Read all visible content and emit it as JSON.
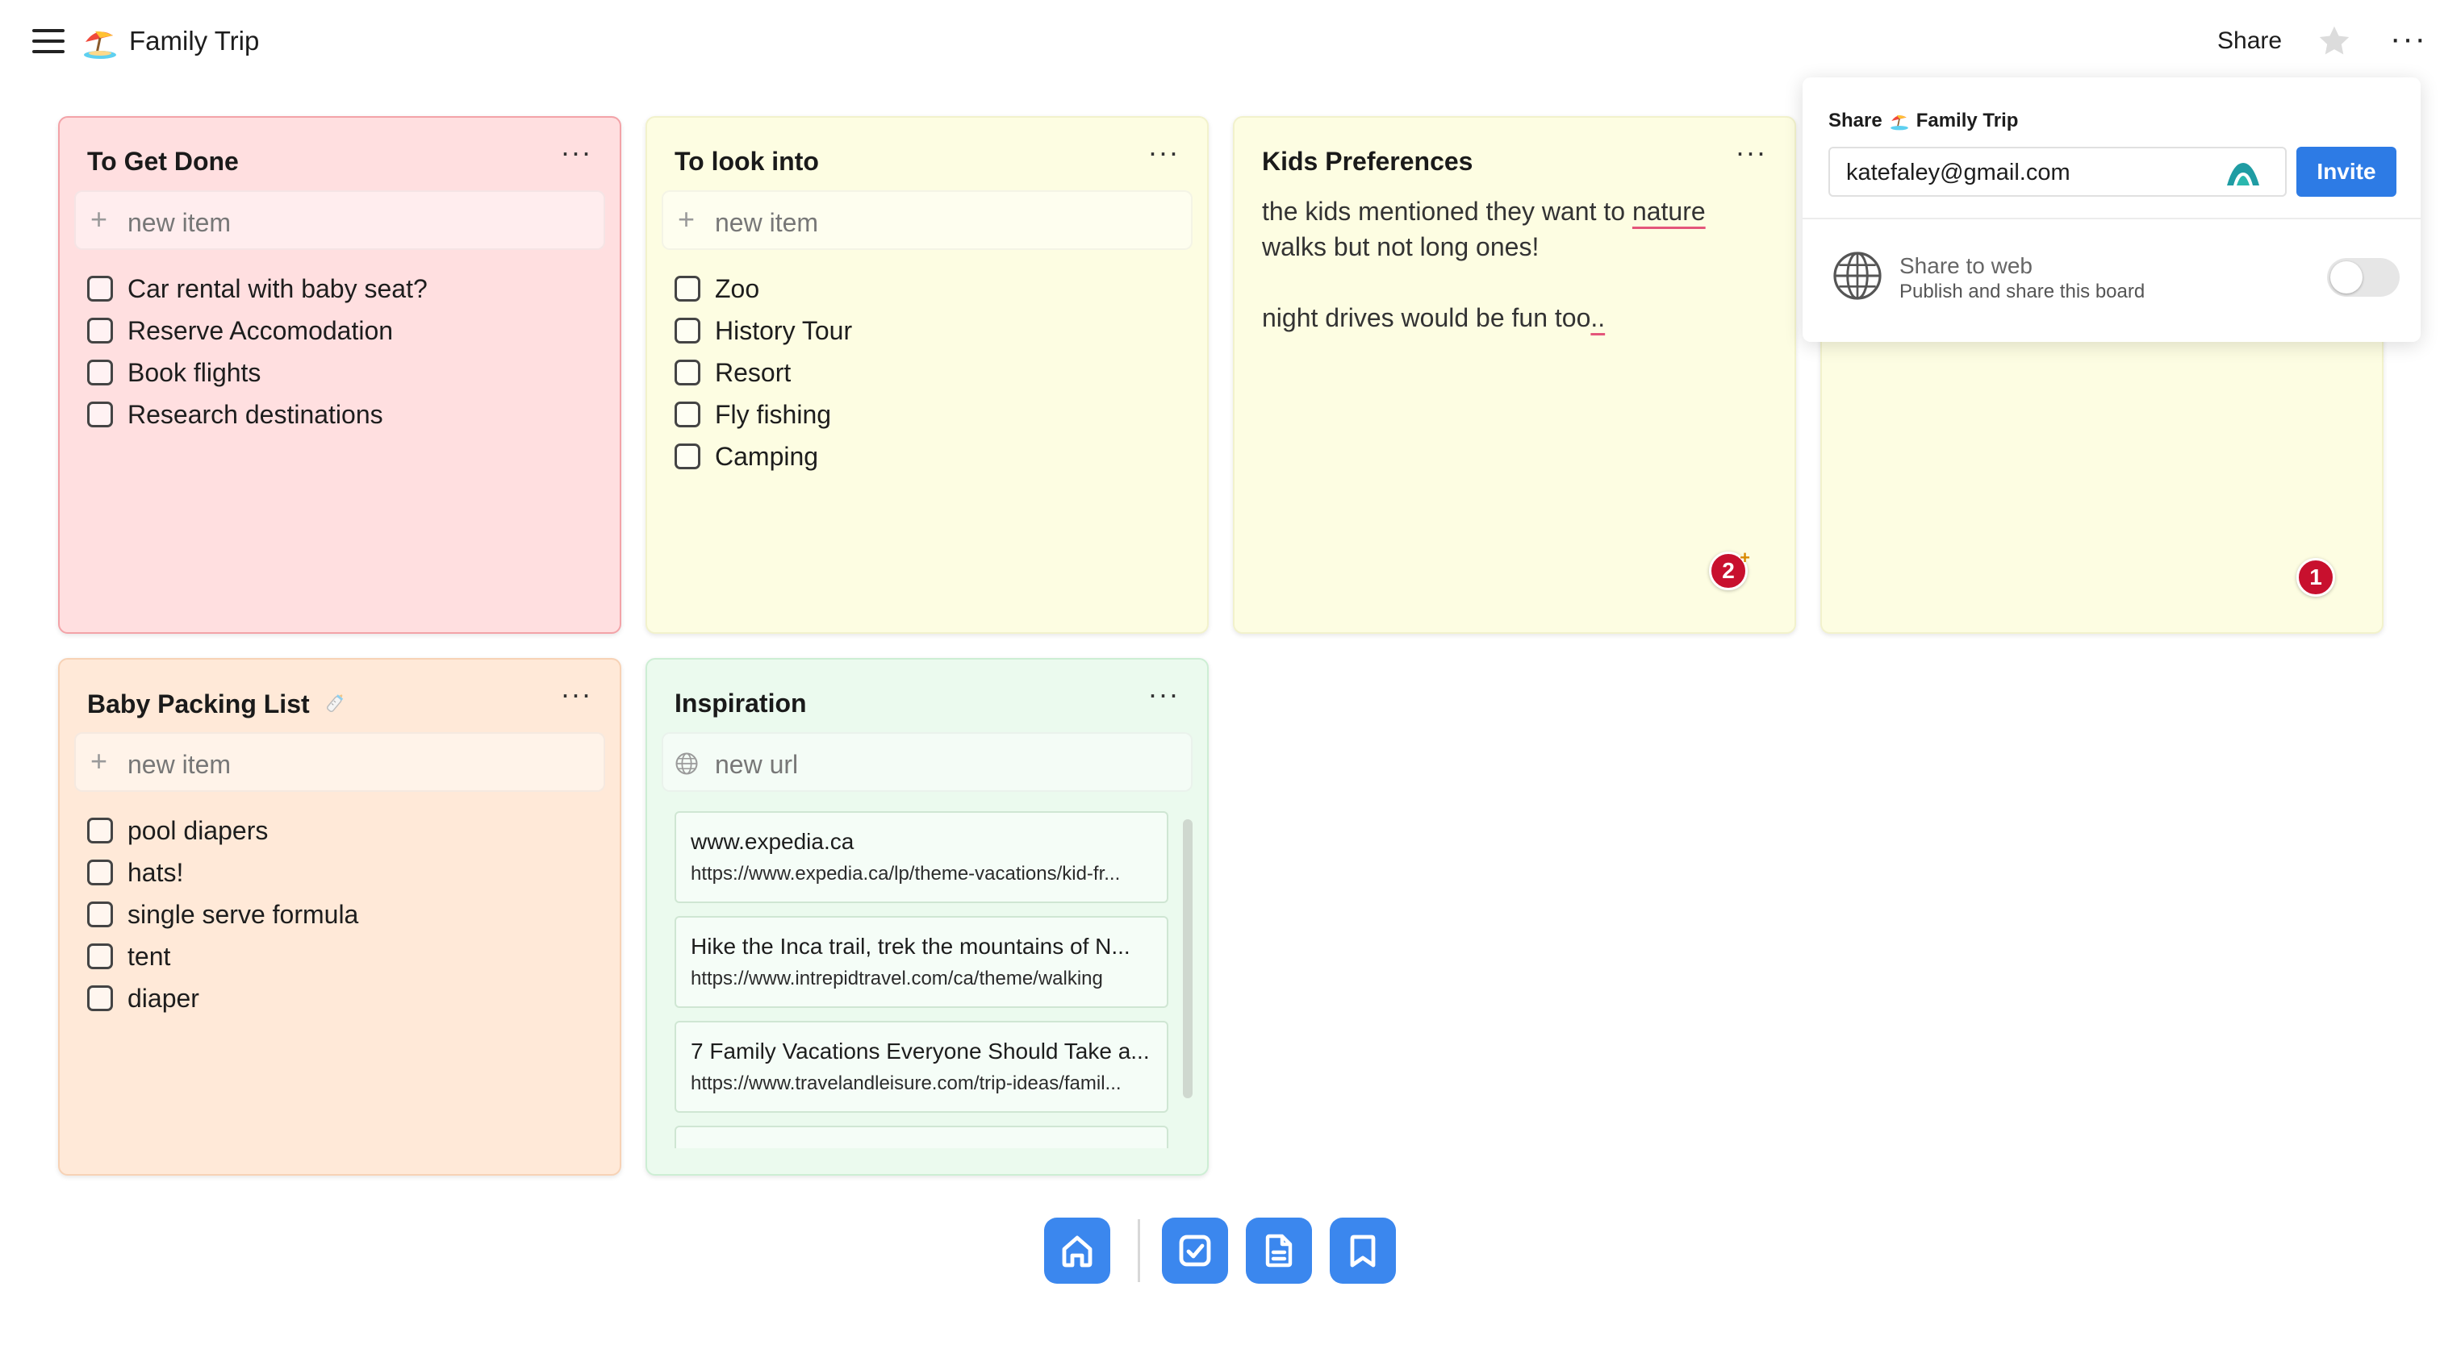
{
  "header": {
    "title": "Family Trip",
    "share_label": "Share"
  },
  "cards": {
    "to_get_done": {
      "title": "To Get Done",
      "new_item_placeholder": "new item",
      "items": [
        "Car rental with baby seat?",
        "Reserve Accomodation",
        "Book flights",
        "Research destinations"
      ],
      "color": "#ffdfe0"
    },
    "to_look_into": {
      "title": "To look into",
      "new_item_placeholder": "new item",
      "items": [
        "Zoo",
        "History Tour",
        "Resort",
        "Fly fishing",
        "Camping"
      ],
      "color": "#fdfde2"
    },
    "kids_preferences": {
      "title": "Kids Preferences",
      "note_part1": "the kids mentioned they want to ",
      "note_underlined": "nature",
      "note_part2": " walks but not long ones!\n\nnight drives would be fun too",
      "note_underlined_end": "..",
      "comment_count": "2",
      "color": "#fdfde2"
    },
    "hidden_card": {
      "comment_count": "1",
      "color": "#fdfde2"
    },
    "baby_packing": {
      "title": "Baby Packing List",
      "new_item_placeholder": "new item",
      "items": [
        "pool diapers",
        "hats!",
        "single serve formula",
        "tent",
        "diaper"
      ],
      "color": "#ffe9d8"
    },
    "inspiration": {
      "title": "Inspiration",
      "new_url_placeholder": "new url",
      "links": [
        {
          "title": "www.expedia.ca",
          "url": "https://www.expedia.ca/lp/theme-vacations/kid-fr..."
        },
        {
          "title": "Hike the Inca trail, trek the mountains of N...",
          "url": "https://www.intrepidtravel.com/ca/theme/walking"
        },
        {
          "title": "7 Family Vacations Everyone Should Take a...",
          "url": "https://www.travelandleisure.com/trip-ideas/famil..."
        }
      ],
      "color": "#ebfaee"
    }
  },
  "share_popover": {
    "heading_prefix": "Share",
    "heading_board": "Family Trip",
    "email_value": "katefaley@gmail.com",
    "invite_label": "Invite",
    "web_title": "Share to web",
    "web_subtitle": "Publish and share this board",
    "web_enabled": false
  },
  "dock": {
    "icons": [
      "home-icon",
      "checkbox-icon",
      "document-icon",
      "bookmark-icon"
    ],
    "accent": "#3b87ee"
  }
}
